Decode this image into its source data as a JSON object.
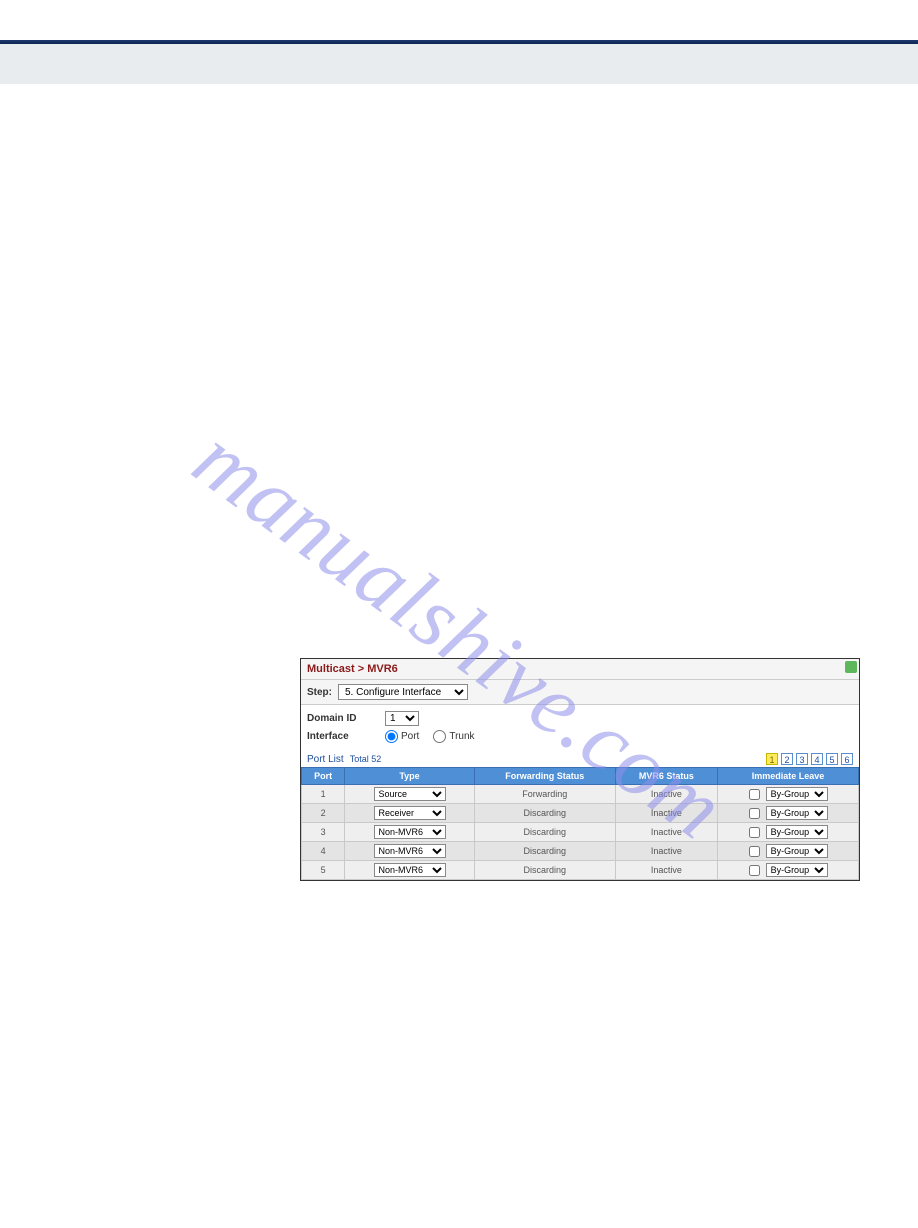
{
  "watermark_text": "manualshive.com",
  "breadcrumb": "Multicast > MVR6",
  "step": {
    "label": "Step:",
    "value": "5. Configure Interface"
  },
  "domain": {
    "label": "Domain ID",
    "value": "1"
  },
  "iface": {
    "label": "Interface",
    "opt_port": "Port",
    "opt_trunk": "Trunk",
    "selected": "Port"
  },
  "port_list": {
    "title": "Port List",
    "total_label": "Total",
    "total_value": "52"
  },
  "pager": {
    "pages": [
      "1",
      "2",
      "3",
      "4",
      "5",
      "6"
    ],
    "active": "1"
  },
  "headers": {
    "port": "Port",
    "type": "Type",
    "fwd": "Forwarding Status",
    "mvr": "MVR6 Status",
    "leave": "Immediate Leave"
  },
  "leave_option": "By-Group",
  "rows": [
    {
      "port": "1",
      "type": "Source",
      "fwd": "Forwarding",
      "mvr": "Inactive"
    },
    {
      "port": "2",
      "type": "Receiver",
      "fwd": "Discarding",
      "mvr": "Inactive"
    },
    {
      "port": "3",
      "type": "Non-MVR6",
      "fwd": "Discarding",
      "mvr": "Inactive"
    },
    {
      "port": "4",
      "type": "Non-MVR6",
      "fwd": "Discarding",
      "mvr": "Inactive"
    },
    {
      "port": "5",
      "type": "Non-MVR6",
      "fwd": "Discarding",
      "mvr": "Inactive"
    }
  ]
}
